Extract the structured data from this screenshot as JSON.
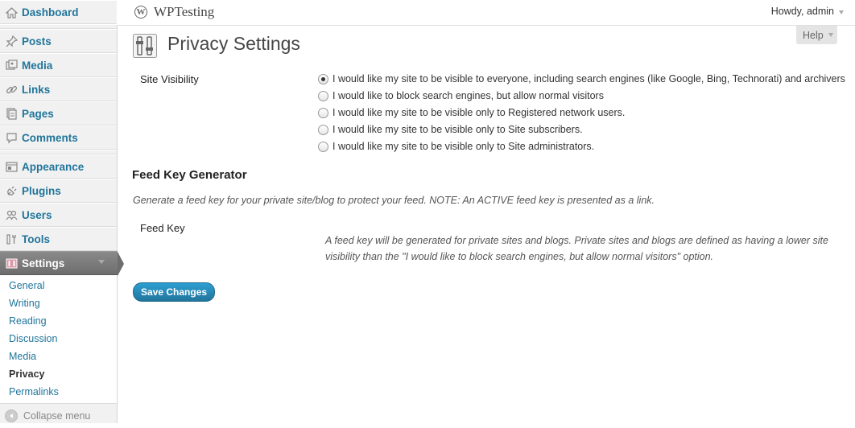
{
  "sidebar": {
    "items": [
      {
        "label": "Dashboard",
        "icon": "dashboard-icon"
      },
      {
        "label": "Posts",
        "icon": "pin-icon"
      },
      {
        "label": "Media",
        "icon": "media-icon"
      },
      {
        "label": "Links",
        "icon": "link-icon"
      },
      {
        "label": "Pages",
        "icon": "pages-icon"
      },
      {
        "label": "Comments",
        "icon": "comment-icon"
      },
      {
        "label": "Appearance",
        "icon": "appearance-icon"
      },
      {
        "label": "Plugins",
        "icon": "plug-icon"
      },
      {
        "label": "Users",
        "icon": "users-icon"
      },
      {
        "label": "Tools",
        "icon": "tools-icon"
      },
      {
        "label": "Settings",
        "icon": "settings-icon"
      }
    ],
    "submenu": [
      "General",
      "Writing",
      "Reading",
      "Discussion",
      "Media",
      "Privacy",
      "Permalinks"
    ],
    "collapse_label": "Collapse menu"
  },
  "header": {
    "site_title": "WPTesting",
    "howdy": "Howdy, admin",
    "help": "Help"
  },
  "page": {
    "title": "Privacy Settings",
    "visibility_label": "Site Visibility",
    "options": [
      "I would like my site to be visible to everyone, including search engines (like Google, Bing, Technorati) and archivers",
      "I would like to block search engines, but allow normal visitors",
      "I would like my site to be visible only to Registered network users.",
      "I would like my site to be visible only to Site subscribers.",
      "I would like my site to be visible only to Site administrators."
    ],
    "feed_heading": "Feed Key Generator",
    "feed_description": "Generate a feed key for your private site/blog to protect your feed. NOTE: An ACTIVE feed key is presented as a link.",
    "feed_key_label": "Feed Key",
    "feed_key_note": "A feed key will be generated for private sites and blogs. Private sites and blogs are defined as having a lower site visibility than the \"I would like to block search engines, but allow normal visitors\" option.",
    "save_label": "Save Changes"
  },
  "colors": {
    "link": "#21759b",
    "button": "#21759b",
    "current_menu": "#777777"
  }
}
